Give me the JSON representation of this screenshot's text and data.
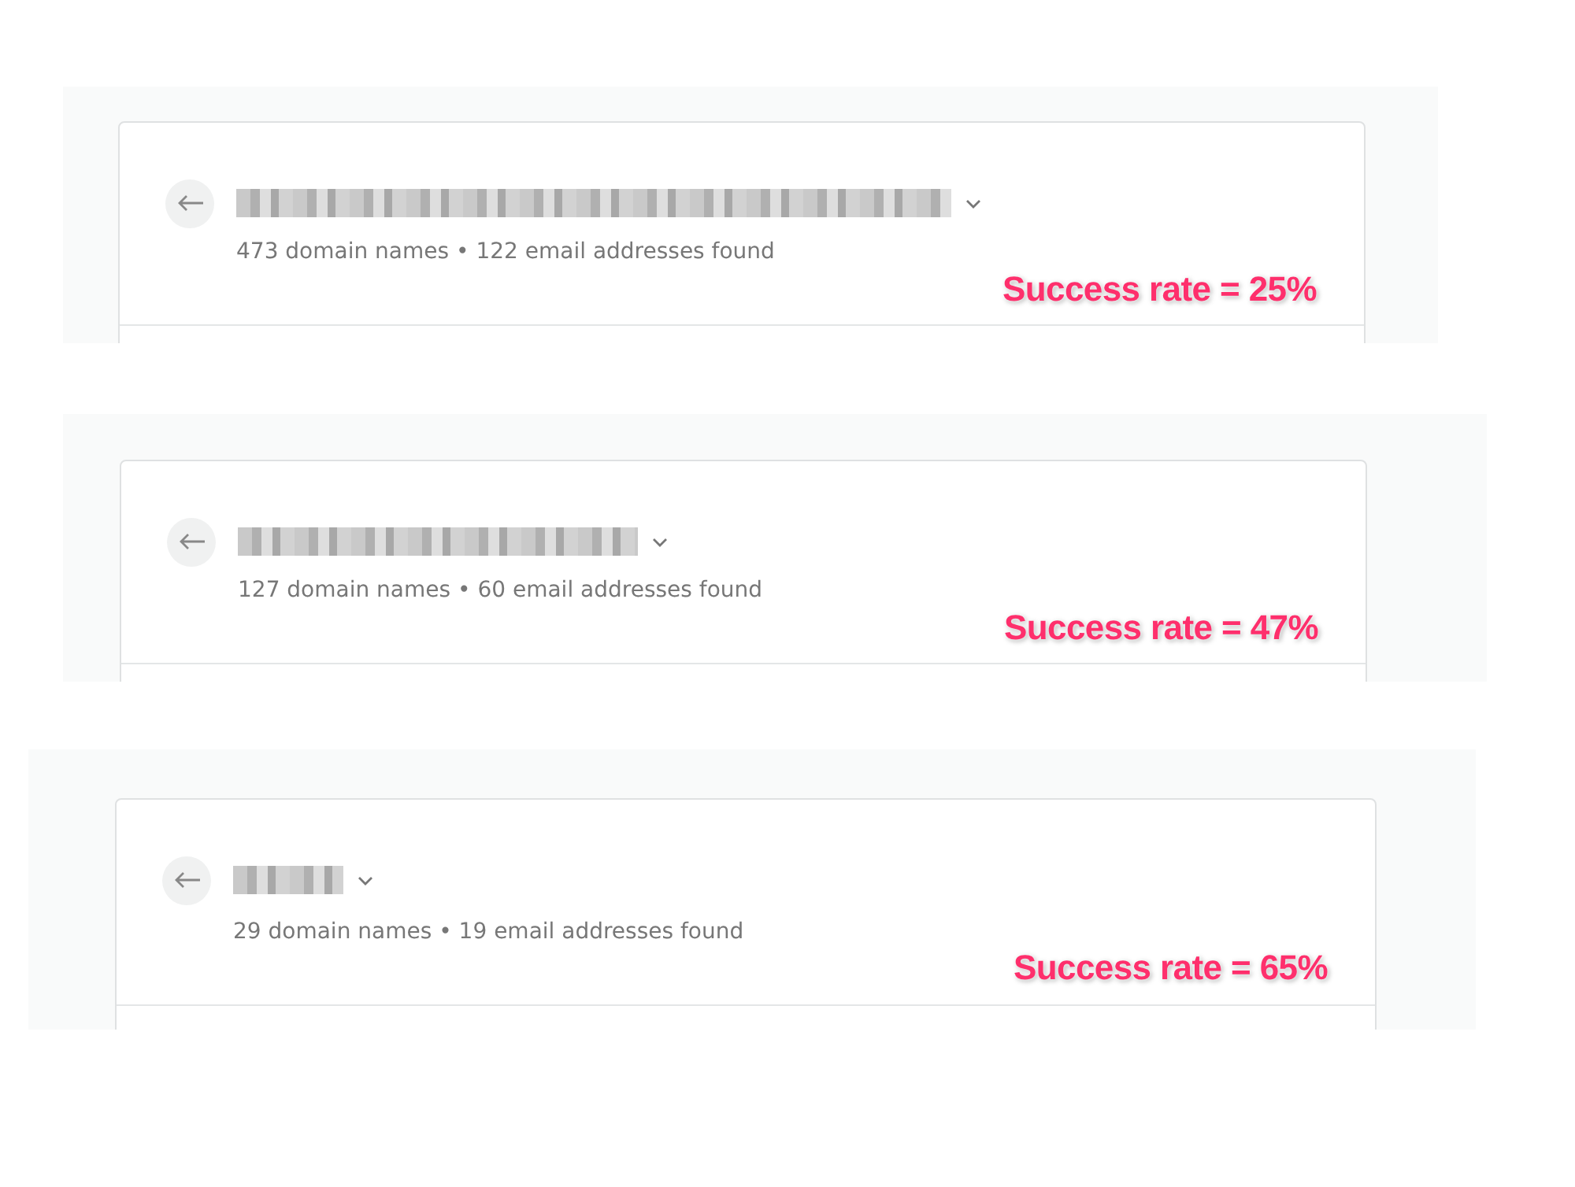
{
  "panels": [
    {
      "stats": "473 domain names • 122 email addresses found",
      "annotation": "Success rate = 25%"
    },
    {
      "stats": "127 domain names • 60 email addresses found",
      "annotation": "Success rate = 47%"
    },
    {
      "stats": "29 domain names • 19 email addresses found",
      "annotation": "Success rate = 65%"
    }
  ]
}
